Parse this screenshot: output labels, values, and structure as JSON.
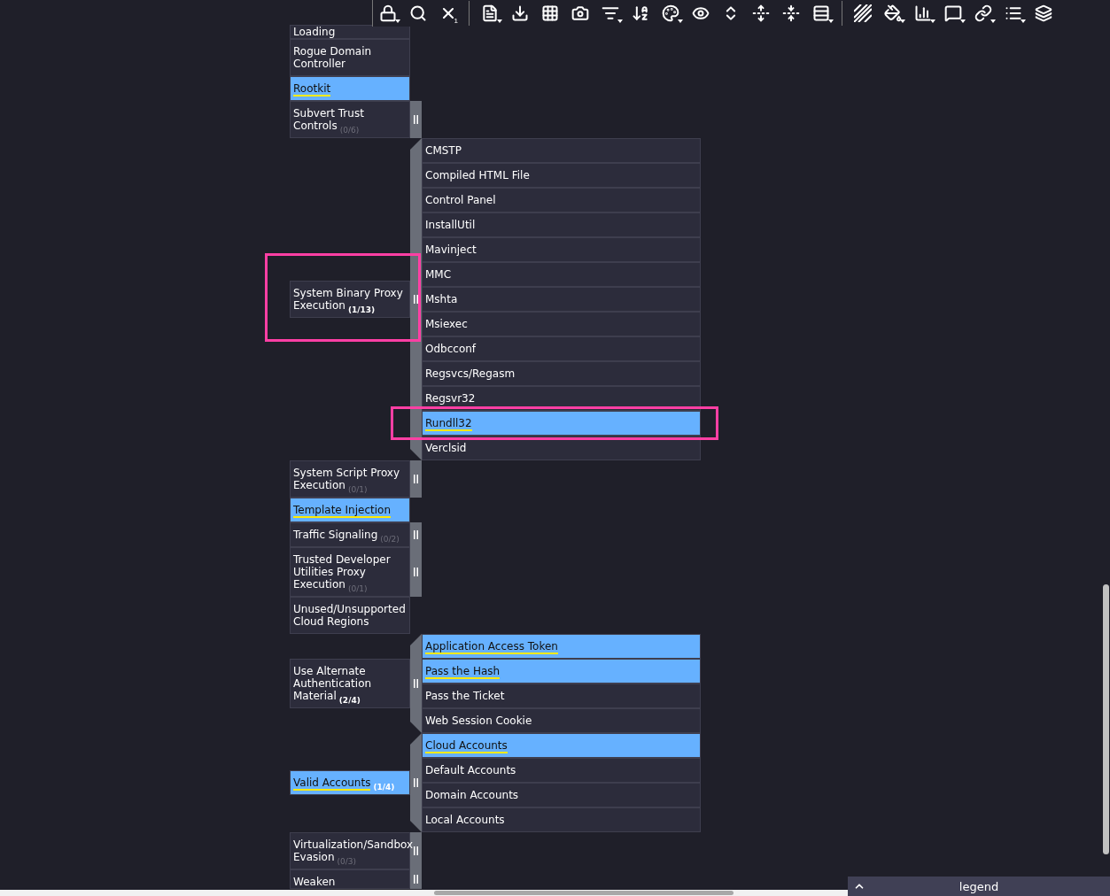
{
  "toolbar": {
    "clear_count": "1"
  },
  "techniques": [
    {
      "name": "Loading",
      "selected": false,
      "annotated": false
    },
    {
      "name": "Rogue Domain Controller",
      "selected": false,
      "annotated": false
    },
    {
      "name": "Rootkit",
      "selected": true,
      "annotated": false
    },
    {
      "name": "Subvert Trust Controls",
      "selected": false,
      "annotated": false,
      "count": "(0/6)",
      "count_active": false,
      "expanded": false
    },
    {
      "name": "System Binary Proxy Execution",
      "selected": false,
      "annotated": true,
      "count": "(1/13)",
      "count_active": true,
      "expanded": true,
      "subtechniques": [
        {
          "name": "CMSTP",
          "selected": false,
          "annotated": false
        },
        {
          "name": "Compiled HTML File",
          "selected": false,
          "annotated": false
        },
        {
          "name": "Control Panel",
          "selected": false,
          "annotated": false
        },
        {
          "name": "InstallUtil",
          "selected": false,
          "annotated": false
        },
        {
          "name": "Mavinject",
          "selected": false,
          "annotated": false
        },
        {
          "name": "MMC",
          "selected": false,
          "annotated": false
        },
        {
          "name": "Mshta",
          "selected": false,
          "annotated": false
        },
        {
          "name": "Msiexec",
          "selected": false,
          "annotated": false
        },
        {
          "name": "Odbcconf",
          "selected": false,
          "annotated": false
        },
        {
          "name": "Regsvcs/Regasm",
          "selected": false,
          "annotated": false
        },
        {
          "name": "Regsvr32",
          "selected": false,
          "annotated": false
        },
        {
          "name": "Rundll32",
          "selected": true,
          "annotated": true
        },
        {
          "name": "Verclsid",
          "selected": false,
          "annotated": false
        }
      ]
    },
    {
      "name": "System Script Proxy Execution",
      "selected": false,
      "annotated": false,
      "count": "(0/1)",
      "count_active": false,
      "expanded": false
    },
    {
      "name": "Template Injection",
      "selected": true,
      "annotated": false
    },
    {
      "name": "Traffic Signaling",
      "selected": false,
      "annotated": false,
      "count": "(0/2)",
      "count_active": false,
      "expanded": false
    },
    {
      "name": "Trusted Developer Utilities Proxy Execution",
      "selected": false,
      "annotated": false,
      "count": "(0/1)",
      "count_active": false,
      "expanded": false
    },
    {
      "name": "Unused/Unsupported Cloud Regions",
      "selected": false,
      "annotated": false
    },
    {
      "name": "Use Alternate Authentication Material",
      "selected": false,
      "annotated": false,
      "count": "(2/4)",
      "count_active": true,
      "expanded": true,
      "subtechniques": [
        {
          "name": "Application Access Token",
          "selected": true,
          "annotated": false
        },
        {
          "name": "Pass the Hash",
          "selected": true,
          "annotated": false
        },
        {
          "name": "Pass the Ticket",
          "selected": false,
          "annotated": false
        },
        {
          "name": "Web Session Cookie",
          "selected": false,
          "annotated": false
        }
      ]
    },
    {
      "name": "Valid Accounts",
      "selected": true,
      "annotated": false,
      "count": "(1/4)",
      "count_active": true,
      "expanded": true,
      "subtechniques": [
        {
          "name": "Cloud Accounts",
          "selected": true,
          "annotated": false
        },
        {
          "name": "Default Accounts",
          "selected": false,
          "annotated": false
        },
        {
          "name": "Domain Accounts",
          "selected": false,
          "annotated": false
        },
        {
          "name": "Local Accounts",
          "selected": false,
          "annotated": false
        }
      ]
    },
    {
      "name": "Virtualization/Sandbox Evasion",
      "selected": false,
      "annotated": false,
      "count": "(0/3)",
      "count_active": false,
      "expanded": false
    },
    {
      "name": "Weaken",
      "selected": false,
      "annotated": false,
      "expanded": false
    }
  ],
  "legend": {
    "label": "legend",
    "expanded": false
  }
}
